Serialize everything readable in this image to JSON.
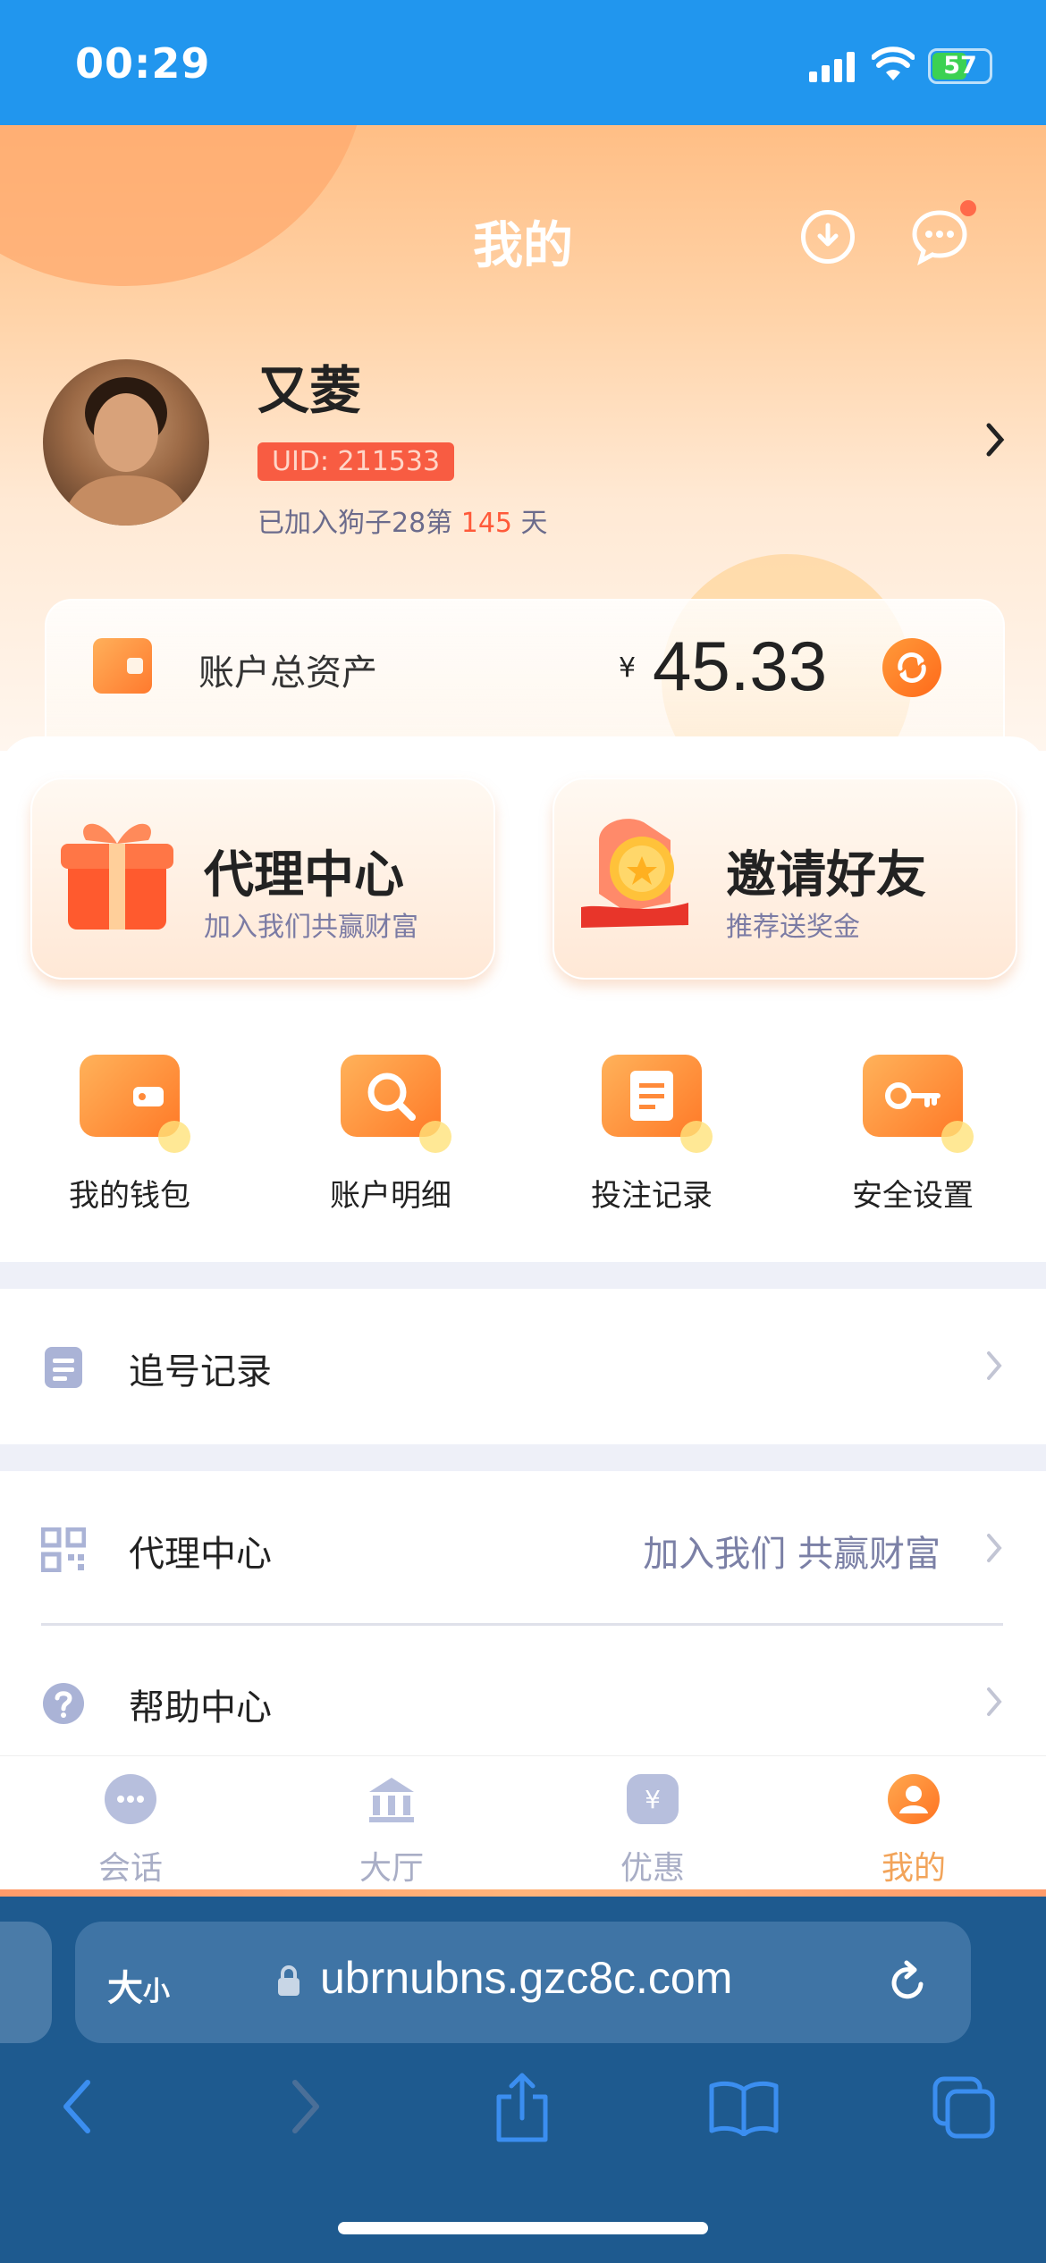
{
  "status_bar": {
    "time": "00:29",
    "battery": "57"
  },
  "header": {
    "title": "我的"
  },
  "profile": {
    "name": "又菱",
    "uid": "UID: 211533",
    "joined_prefix": "已加入狗子28第",
    "joined_days": "145",
    "joined_suffix": "天"
  },
  "assets": {
    "label": "账户总资产",
    "currency": "¥",
    "value": "45.33"
  },
  "promos": [
    {
      "title": "代理中心",
      "subtitle": "加入我们共赢财富"
    },
    {
      "title": "邀请好友",
      "subtitle": "推荐送奖金"
    }
  ],
  "quick_actions": [
    {
      "label": "我的钱包",
      "icon": "wallet-icon"
    },
    {
      "label": "账户明细",
      "icon": "magnifier-icon"
    },
    {
      "label": "投注记录",
      "icon": "ticket-icon"
    },
    {
      "label": "安全设置",
      "icon": "key-icon"
    }
  ],
  "menu": [
    {
      "label": "追号记录",
      "icon": "clipboard-icon"
    },
    {
      "label": "代理中心",
      "extra": "加入我们 共赢财富",
      "icon": "qrcode-icon"
    },
    {
      "label": "帮助中心",
      "icon": "help-icon"
    }
  ],
  "tabs": [
    {
      "label": "会话",
      "icon": "chat-bubble-icon"
    },
    {
      "label": "大厅",
      "icon": "bank-icon"
    },
    {
      "label": "优惠",
      "icon": "coupon-icon"
    },
    {
      "label": "我的",
      "icon": "user-icon",
      "active": true
    }
  ],
  "browser": {
    "text_size_label": "大",
    "text_size_small": "小",
    "url": "ubrnubns.gzc8c.com"
  },
  "colors": {
    "status_bar": "#2196ee",
    "accent": "#ff7a28",
    "browser": "#1e5a8f"
  }
}
